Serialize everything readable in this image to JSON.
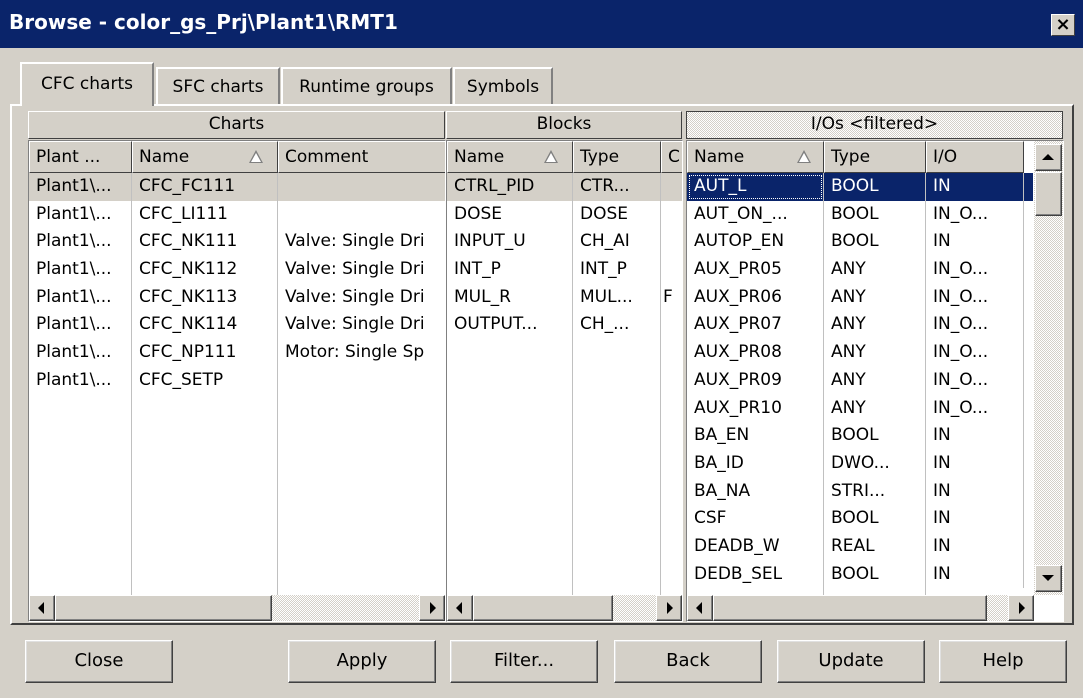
{
  "window": {
    "title": "Browse - color_gs_Prj\\Plant1\\RMT1",
    "close_glyph": "×"
  },
  "tabs": [
    {
      "label": "CFC charts",
      "active": true
    },
    {
      "label": "SFC charts",
      "active": false
    },
    {
      "label": "Runtime groups",
      "active": false
    },
    {
      "label": "Symbols",
      "active": false
    }
  ],
  "charts": {
    "group_label": "Charts",
    "columns": [
      "Plant ...",
      "Name",
      "Comment"
    ],
    "sort_column": "Name",
    "rows": [
      {
        "plant": "Plant1\\...",
        "name": "CFC_FC111",
        "comment": ""
      },
      {
        "plant": "Plant1\\...",
        "name": "CFC_LI111",
        "comment": ""
      },
      {
        "plant": "Plant1\\...",
        "name": "CFC_NK111",
        "comment": "Valve: Single Dri"
      },
      {
        "plant": "Plant1\\...",
        "name": "CFC_NK112",
        "comment": "Valve: Single Dri"
      },
      {
        "plant": "Plant1\\...",
        "name": "CFC_NK113",
        "comment": "Valve: Single Dri"
      },
      {
        "plant": "Plant1\\...",
        "name": "CFC_NK114",
        "comment": "Valve: Single Dri"
      },
      {
        "plant": "Plant1\\...",
        "name": "CFC_NP111",
        "comment": "Motor: Single Sp"
      },
      {
        "plant": "Plant1\\...",
        "name": "CFC_SETP",
        "comment": ""
      }
    ],
    "selected_row": 0
  },
  "blocks": {
    "group_label": "Blocks",
    "columns": [
      "Name",
      "Type",
      "C"
    ],
    "sort_column": "Name",
    "rows": [
      {
        "name": "CTRL_PID",
        "type": "CTR...",
        "c": ""
      },
      {
        "name": "DOSE",
        "type": "DOSE",
        "c": ""
      },
      {
        "name": "INPUT_U",
        "type": "CH_AI",
        "c": ""
      },
      {
        "name": "INT_P",
        "type": "INT_P",
        "c": ""
      },
      {
        "name": "MUL_R",
        "type": "MUL...",
        "c": "F"
      },
      {
        "name": "OUTPUT...",
        "type": "CH_...",
        "c": ""
      }
    ],
    "selected_row": 0
  },
  "ios": {
    "group_label": "I/Os <filtered>",
    "columns": [
      "Name",
      "Type",
      "I/O"
    ],
    "sort_column": "Name",
    "rows": [
      {
        "name": "AUT_L",
        "type": "BOOL",
        "io": "IN"
      },
      {
        "name": "AUT_ON_...",
        "type": "BOOL",
        "io": "IN_O..."
      },
      {
        "name": "AUTOP_EN",
        "type": "BOOL",
        "io": "IN"
      },
      {
        "name": "AUX_PR05",
        "type": "ANY",
        "io": "IN_O..."
      },
      {
        "name": "AUX_PR06",
        "type": "ANY",
        "io": "IN_O..."
      },
      {
        "name": "AUX_PR07",
        "type": "ANY",
        "io": "IN_O..."
      },
      {
        "name": "AUX_PR08",
        "type": "ANY",
        "io": "IN_O..."
      },
      {
        "name": "AUX_PR09",
        "type": "ANY",
        "io": "IN_O..."
      },
      {
        "name": "AUX_PR10",
        "type": "ANY",
        "io": "IN_O..."
      },
      {
        "name": "BA_EN",
        "type": "BOOL",
        "io": "IN"
      },
      {
        "name": "BA_ID",
        "type": "DWO...",
        "io": "IN"
      },
      {
        "name": "BA_NA",
        "type": "STRI...",
        "io": "IN"
      },
      {
        "name": "CSF",
        "type": "BOOL",
        "io": "IN"
      },
      {
        "name": "DEADB_W",
        "type": "REAL",
        "io": "IN"
      },
      {
        "name": "DEDB_SEL",
        "type": "BOOL",
        "io": "IN"
      }
    ],
    "selected_row": 0
  },
  "buttons": {
    "close": "Close",
    "apply": "Apply",
    "filter": "Filter...",
    "back": "Back",
    "update": "Update",
    "help": "Help"
  },
  "colors": {
    "titlebar": "#0a246a",
    "face": "#d4d0c8",
    "selection": "#0a246a"
  }
}
